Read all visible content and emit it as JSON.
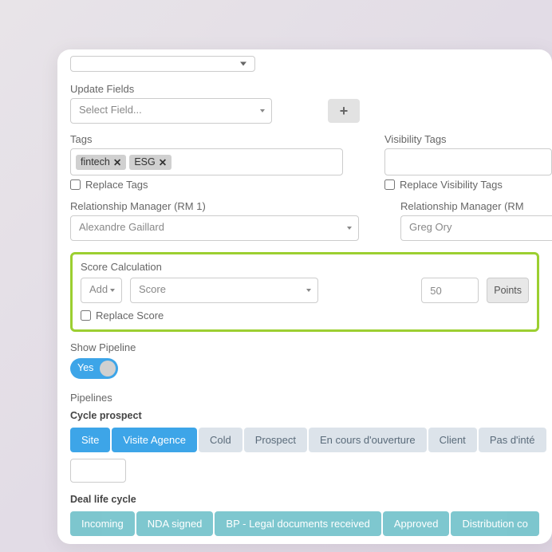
{
  "update_fields": {
    "label": "Update Fields",
    "placeholder": "Select Field..."
  },
  "tags": {
    "label": "Tags",
    "items": [
      "fintech",
      "ESG"
    ],
    "replace_label": "Replace Tags"
  },
  "visibility": {
    "label": "Visibility Tags",
    "replace_label": "Replace Visibility Tags"
  },
  "rm1": {
    "label": "Relationship Manager (RM 1)",
    "value": "Alexandre Gaillard"
  },
  "rm2": {
    "label": "Relationship Manager (RM",
    "value": "Greg Ory"
  },
  "score": {
    "label": "Score Calculation",
    "op": "Add",
    "field": "Score",
    "value": "50",
    "unit": "Points",
    "replace_label": "Replace Score"
  },
  "show_pipeline": {
    "label": "Show Pipeline",
    "value": "Yes"
  },
  "pipelines": {
    "label": "Pipelines",
    "p1": {
      "title": "Cycle prospect",
      "stages": [
        "Site",
        "Visite Agence",
        "Cold",
        "Prospect",
        "En cours d'ouverture",
        "Client",
        "Pas d'inté"
      ]
    },
    "p2": {
      "title": "Deal life cycle",
      "stages": [
        "Incoming",
        "NDA signed",
        "BP - Legal documents received",
        "Approved",
        "Distribution co"
      ]
    }
  }
}
